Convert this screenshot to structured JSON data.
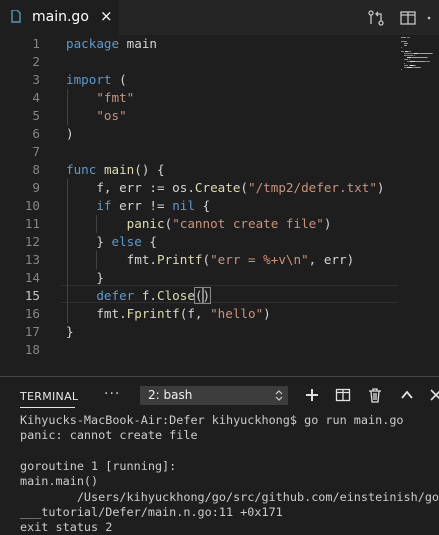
{
  "tab": {
    "filename": "main.go",
    "close_glyph": "×",
    "icon": "file-icon",
    "icon_color": "#519aba"
  },
  "editor": {
    "line_numbers": [
      "1",
      "2",
      "3",
      "4",
      "5",
      "6",
      "7",
      "8",
      "9",
      "10",
      "11",
      "12",
      "13",
      "14",
      "15",
      "16",
      "17",
      "18"
    ],
    "current_line": "15",
    "lines": [
      [
        [
          "kw",
          "package"
        ],
        [
          "pl",
          " main"
        ]
      ],
      [],
      [
        [
          "kw",
          "import"
        ],
        [
          "pl",
          " ("
        ]
      ],
      [
        [
          "pl",
          "    "
        ],
        [
          "str",
          "\"fmt\""
        ]
      ],
      [
        [
          "pl",
          "    "
        ],
        [
          "str",
          "\"os\""
        ]
      ],
      [
        [
          "pl",
          ")"
        ]
      ],
      [],
      [
        [
          "kw",
          "func"
        ],
        [
          "pl",
          " "
        ],
        [
          "fn",
          "main"
        ],
        [
          "pl",
          "() {"
        ]
      ],
      [
        [
          "pl",
          "    f, err := os."
        ],
        [
          "fn",
          "Create"
        ],
        [
          "pl",
          "("
        ],
        [
          "str",
          "\"/tmp2/defer.txt\""
        ],
        [
          "pl",
          ")"
        ]
      ],
      [
        [
          "pl",
          "    "
        ],
        [
          "kw",
          "if"
        ],
        [
          "pl",
          " err != "
        ],
        [
          "kw",
          "nil"
        ],
        [
          "pl",
          " {"
        ]
      ],
      [
        [
          "pl",
          "        "
        ],
        [
          "fn",
          "panic"
        ],
        [
          "pl",
          "("
        ],
        [
          "str",
          "\"cannot create file\""
        ],
        [
          "pl",
          ")"
        ]
      ],
      [
        [
          "pl",
          "    } "
        ],
        [
          "kw",
          "else"
        ],
        [
          "pl",
          " {"
        ]
      ],
      [
        [
          "pl",
          "        fmt."
        ],
        [
          "fn",
          "Printf"
        ],
        [
          "pl",
          "("
        ],
        [
          "str",
          "\"err = %+v\\n\""
        ],
        [
          "pl",
          ", err)"
        ]
      ],
      [
        [
          "pl",
          "    }"
        ]
      ],
      [
        [
          "pl",
          "    "
        ],
        [
          "kw",
          "defer"
        ],
        [
          "pl",
          " f."
        ],
        [
          "fn",
          "Close"
        ],
        [
          "br",
          "("
        ],
        [
          "br",
          ")"
        ]
      ],
      [
        [
          "pl",
          "    fmt."
        ],
        [
          "fn",
          "Fprintf"
        ],
        [
          "pl",
          "(f, "
        ],
        [
          "str",
          "\"hello\""
        ],
        [
          "pl",
          ")"
        ]
      ],
      [
        [
          "pl",
          "}"
        ]
      ],
      []
    ]
  },
  "panel": {
    "title": "TERMINAL",
    "more_label": "···",
    "terminal_select": "2: bash",
    "terminal_lines": [
      "Kihyucks-MacBook-Air:Defer kihyuckhong$ go run main.go",
      "panic: cannot create file",
      "",
      "goroutine 1 [running]:",
      "main.main()",
      "        /Users/kihyuckhong/go/src/github.com/einsteinish/go",
      "___tutorial/Defer/main.n.go:11 +0x171",
      "exit status 2"
    ]
  },
  "colors": {
    "keyword": "#569cd6",
    "function": "#dcdcaa",
    "string": "#ce9178",
    "plain": "#d4d4d4"
  }
}
